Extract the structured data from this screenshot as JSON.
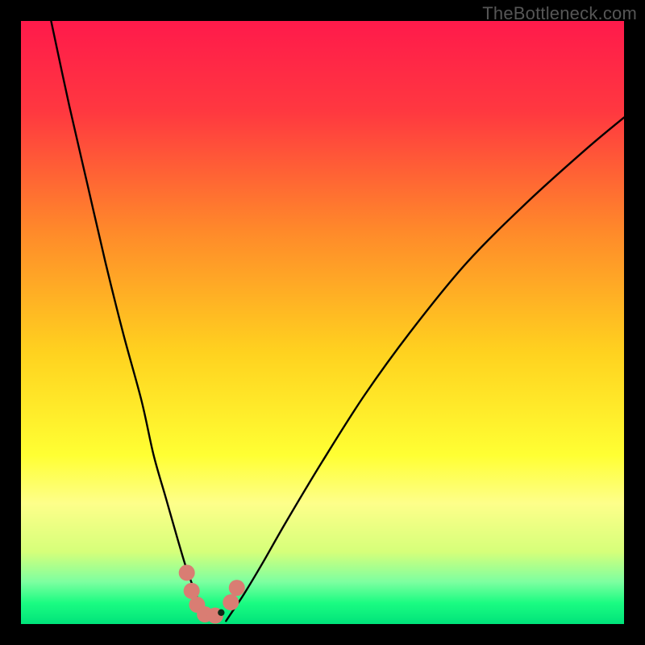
{
  "watermark": {
    "text": "TheBottleneck.com"
  },
  "chart_data": {
    "type": "line",
    "title": "",
    "xlabel": "",
    "ylabel": "",
    "xlim": [
      0,
      100
    ],
    "ylim": [
      0,
      100
    ],
    "gradient_stops": [
      {
        "pos": 0.0,
        "color": "#ff1a4b"
      },
      {
        "pos": 0.15,
        "color": "#ff3840"
      },
      {
        "pos": 0.35,
        "color": "#ff8a2a"
      },
      {
        "pos": 0.55,
        "color": "#ffd21f"
      },
      {
        "pos": 0.72,
        "color": "#ffff33"
      },
      {
        "pos": 0.8,
        "color": "#feff8a"
      },
      {
        "pos": 0.88,
        "color": "#d6ff7a"
      },
      {
        "pos": 0.93,
        "color": "#7dffa0"
      },
      {
        "pos": 0.965,
        "color": "#1bfc82"
      },
      {
        "pos": 1.0,
        "color": "#00e37a"
      }
    ],
    "series": [
      {
        "name": "curve-left",
        "x": [
          5,
          8,
          11,
          14,
          17,
          20,
          22,
          24,
          26,
          27.5,
          29,
          30,
          30.5
        ],
        "y": [
          100,
          86,
          73,
          60,
          48,
          37,
          28,
          21,
          14,
          9,
          5,
          2,
          0.5
        ]
      },
      {
        "name": "curve-right",
        "x": [
          34,
          35,
          37,
          40,
          44,
          50,
          57,
          65,
          74,
          84,
          94,
          100
        ],
        "y": [
          0.5,
          2,
          5,
          10,
          17,
          27,
          38,
          49,
          60,
          70,
          79,
          84
        ]
      }
    ],
    "markers": [
      {
        "name": "m1",
        "x": 27.5,
        "y": 8.5
      },
      {
        "name": "m2",
        "x": 28.3,
        "y": 5.5
      },
      {
        "name": "m3",
        "x": 29.2,
        "y": 3.2
      },
      {
        "name": "m4",
        "x": 30.5,
        "y": 1.6
      },
      {
        "name": "m5",
        "x": 32.2,
        "y": 1.4
      },
      {
        "name": "m6",
        "x": 34.8,
        "y": 3.6
      },
      {
        "name": "m7",
        "x": 35.8,
        "y": 6.0
      }
    ],
    "point": {
      "x": 33.2,
      "y": 1.9
    },
    "marker_color": "#d97d73",
    "point_color": "#0a2a16",
    "line_color": "#000000"
  }
}
